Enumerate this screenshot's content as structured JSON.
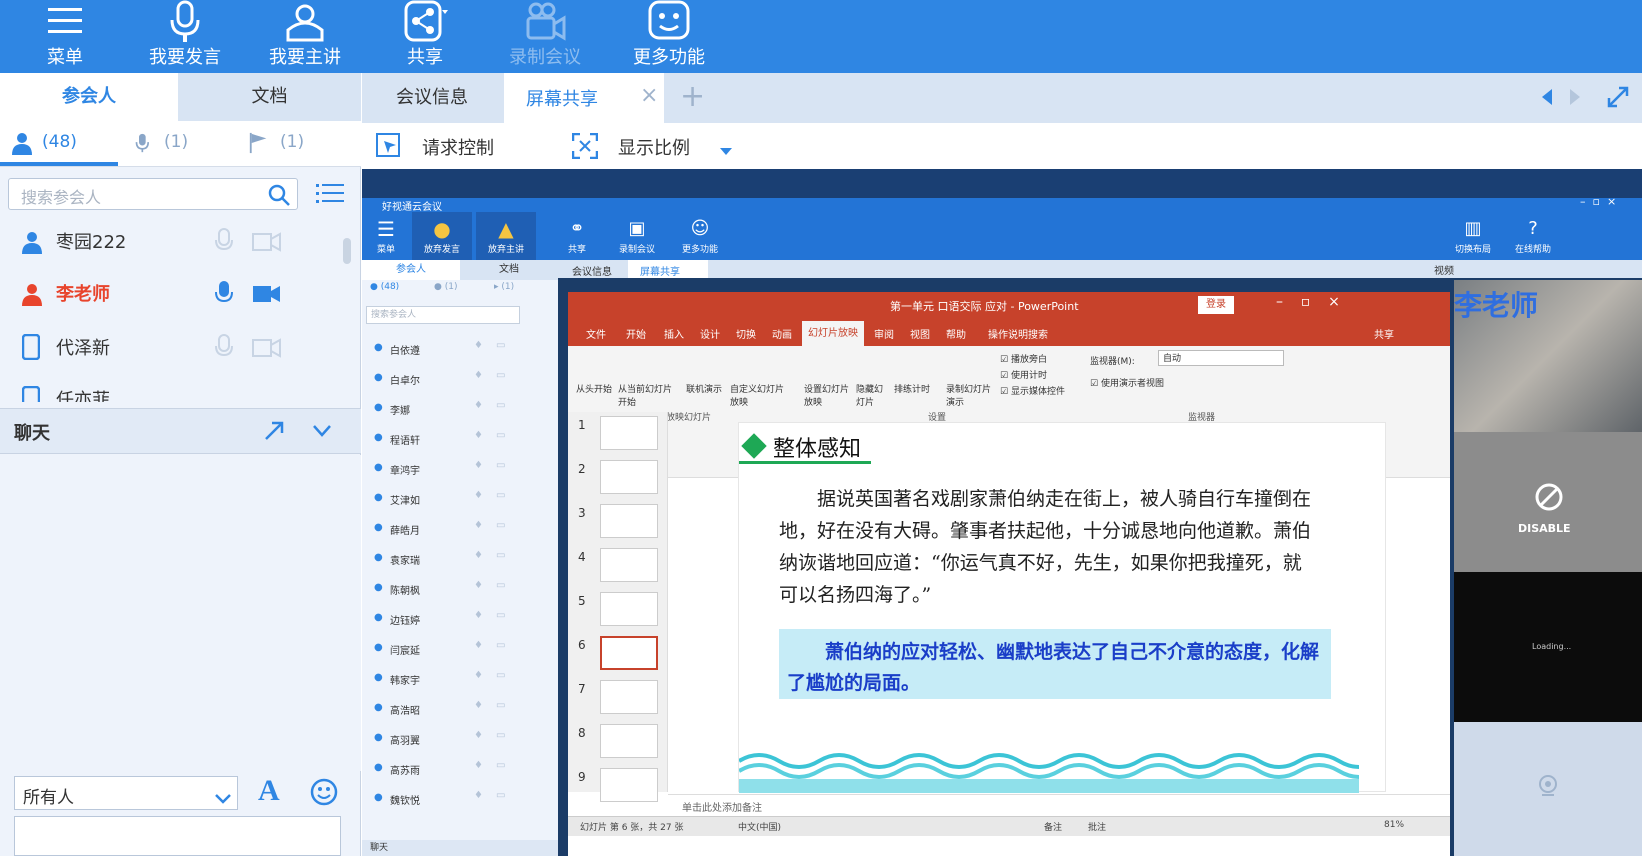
{
  "toolbar": {
    "menu": "菜单",
    "speak": "我要发言",
    "host": "我要主讲",
    "share": "共享",
    "record": "录制会议",
    "more": "更多功能"
  },
  "left": {
    "tabs": [
      "参会人",
      "文档"
    ],
    "counts": [
      "(48)",
      "(1)",
      "(1)"
    ],
    "search_placeholder": "搜索参会人",
    "members": [
      "枣园222",
      "李老师",
      "代泽新",
      "任亦菲"
    ],
    "chat": "聊天",
    "recipient": "所有人"
  },
  "right": {
    "tabs": [
      "会议信息",
      "屏幕共享"
    ],
    "request": "请求控制",
    "ratio": "显示比例"
  },
  "shared_app": {
    "title": "好视通云会议",
    "tools": [
      "菜单",
      "放弃发言",
      "放弃主讲",
      "共享",
      "录制会议",
      "更多功能"
    ],
    "right_tools": [
      "切换布局",
      "在线帮助"
    ],
    "tabs": [
      "会议信息",
      "屏幕共享"
    ],
    "left_tabs": [
      "参会人",
      "文档"
    ],
    "search": "搜索参会人",
    "counts": [
      "(48)",
      "(1)",
      "(1)"
    ],
    "members": [
      "白依遵",
      "白卓尔",
      "李娜",
      "程语轩",
      "章鸿宇",
      "艾津如",
      "薛皓月",
      "袁家瑞",
      "陈朝枫",
      "边钰婷",
      "闫宸延",
      "韩家宇",
      "高浩昭",
      "高羽翼",
      "高苏雨",
      "魏钦悦"
    ],
    "chat": "聊天",
    "video_label": "视频",
    "disable": "DISABLE",
    "loading": "Loading..."
  },
  "powerpoint": {
    "title": "第一单元 口语交际 应对 - PowerPoint",
    "login": "登录",
    "tabs": [
      "文件",
      "开始",
      "插入",
      "设计",
      "切换",
      "动画",
      "幻灯片放映",
      "审阅",
      "视图",
      "帮助"
    ],
    "tellme": "操作说明搜索",
    "share": "共享",
    "groups": [
      "开始放映幻灯片",
      "设置",
      "监视器"
    ],
    "btns": [
      "从头开始",
      "从当前幻灯片开始",
      "联机演示",
      "自定义幻灯片放映",
      "设置幻灯片放映",
      "隐藏幻灯片",
      "排练计时",
      "录制幻灯片演示"
    ],
    "checks": [
      "播放旁白",
      "使用计时",
      "显示媒体控件"
    ],
    "monitor": "监视器(M):",
    "monitor_val": "自动",
    "presenter": "使用演示者视图",
    "slide_title": "整体感知",
    "para": "据说英国著名戏剧家萧伯纳走在街上，被人骑自行车撞倒在地，好在没有大碍。肇事者扶起他，十分诚恳地向他道歉。萧伯纳诙谐地回应道：“你运气真不好，先生，如果你把我撞死，就可以名扬四海了。”",
    "callout": "萧伯纳的应对轻松、幽默地表达了自己不介意的态度，化解了尴尬的局面。",
    "notes": "单击此处添加备注",
    "status": "幻灯片 第 6 张，共 27 张",
    "lang": "中文(中国)",
    "notes_btn": "备注",
    "comments": "批注",
    "zoom": "81%",
    "slides": [
      "1",
      "2",
      "3",
      "4",
      "5",
      "6",
      "7",
      "8",
      "9"
    ]
  },
  "overlay_name": "李老师"
}
